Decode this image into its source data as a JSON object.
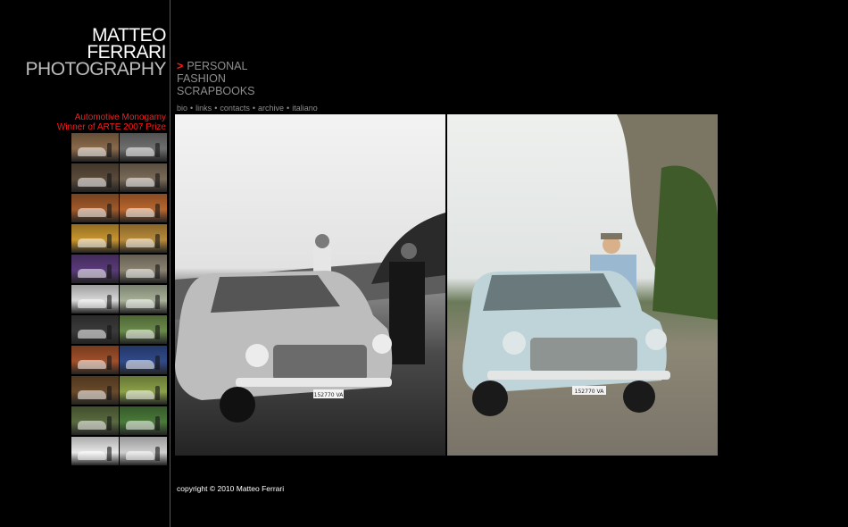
{
  "logo": {
    "line1": "MATTEO",
    "line2": "FERRARI",
    "line3": "PHOTOGRAPHY"
  },
  "series": {
    "title": "Automotive Monogamy",
    "subtitle": "Winner of ARTE 2007 Prize"
  },
  "thumbnails": [
    {
      "color": "#8a6a4a"
    },
    {
      "color": "#6f6f6f"
    },
    {
      "color": "#5a4a3a"
    },
    {
      "color": "#7a6a58"
    },
    {
      "color": "#a05a2a"
    },
    {
      "color": "#b8662e"
    },
    {
      "color": "#c8952f"
    },
    {
      "color": "#b88a3a"
    },
    {
      "color": "#5a3a7a"
    },
    {
      "color": "#8a8270"
    },
    {
      "color": "#d8d8d8"
    },
    {
      "color": "#a8b098"
    },
    {
      "color": "#3a3a3a"
    },
    {
      "color": "#6a8a4a"
    },
    {
      "color": "#a0502a"
    },
    {
      "color": "#304a8a"
    },
    {
      "color": "#6a4a2a"
    },
    {
      "color": "#8aa048"
    },
    {
      "color": "#5a6a40"
    },
    {
      "color": "#4a7a3a"
    },
    {
      "color": "#e8e8e8"
    },
    {
      "color": "#d0d0d0"
    }
  ],
  "nav": {
    "arrow": ">",
    "menu": [
      "PERSONAL",
      "FASHION",
      "SCRAPBOOKS"
    ],
    "links": [
      "bio",
      "links",
      "contacts",
      "archive",
      "italiano"
    ],
    "separator": "•"
  },
  "photos": {
    "left": {
      "plate": "152770 VA"
    },
    "right": {
      "plate": "152770 VA"
    }
  },
  "footer": {
    "copyright": "copyright © 2010 Matteo Ferrari"
  }
}
